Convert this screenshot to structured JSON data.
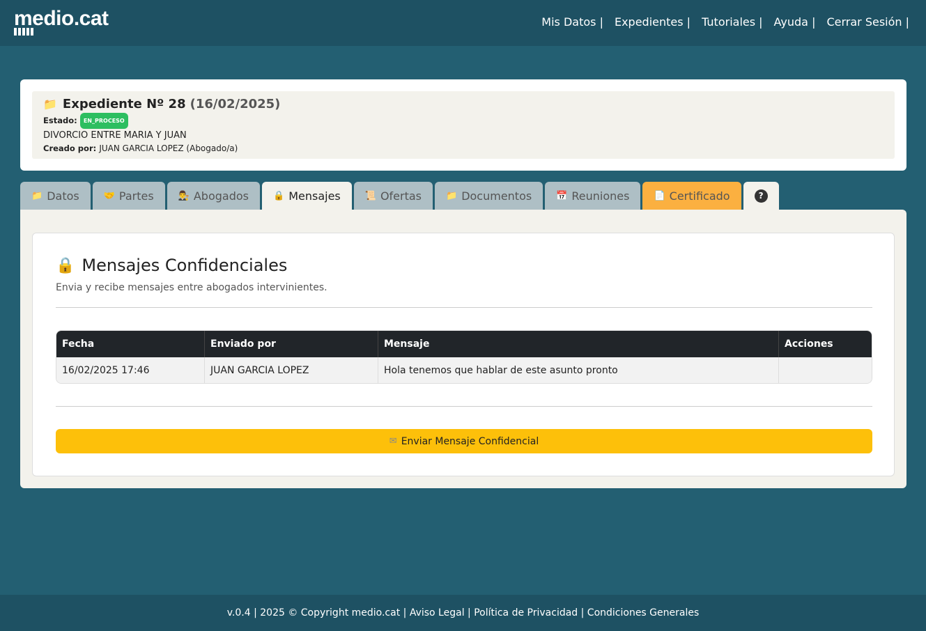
{
  "brand": {
    "name": "medio.cat"
  },
  "nav": {
    "items": [
      "Mis Datos |",
      "Expedientes |",
      "Tutoriales |",
      "Ayuda |",
      "Cerrar Sesión |"
    ]
  },
  "expediente": {
    "title": "Expediente Nº 28",
    "date": "(16/02/2025)",
    "estado_label": "Estado:",
    "estado_badge": "EN_PROCESO",
    "description": "DIVORCIO ENTRE MARIA Y JUAN",
    "creado_label": "Creado por:",
    "creado_value": "JUAN GARCIA LOPEZ (Abogado/a)"
  },
  "tabs": [
    {
      "label": "Datos",
      "icon": "folder-icon"
    },
    {
      "label": "Partes",
      "icon": "handshake-icon"
    },
    {
      "label": "Abogados",
      "icon": "lawyer-icon"
    },
    {
      "label": "Mensajes",
      "icon": "lock-icon"
    },
    {
      "label": "Ofertas",
      "icon": "scroll-icon"
    },
    {
      "label": "Documentos",
      "icon": "folder-icon"
    },
    {
      "label": "Reuniones",
      "icon": "calendar-icon"
    },
    {
      "label": "Certificado",
      "icon": "document-icon"
    }
  ],
  "section": {
    "title": "Mensajes Confidenciales",
    "subtitle": "Envia y recibe mensajes entre abogados intervinientes."
  },
  "table": {
    "headers": [
      "Fecha",
      "Enviado por",
      "Mensaje",
      "Acciones"
    ],
    "rows": [
      [
        "16/02/2025 17:46",
        "JUAN GARCIA LOPEZ",
        "Hola tenemos que hablar de este asunto pronto",
        ""
      ]
    ]
  },
  "send_button": {
    "label": "Enviar Mensaje Confidencial"
  },
  "footer": {
    "text": "v.0.4 | 2025 © Copyright medio.cat | Aviso Legal | Política de Privacidad | Condiciones Generales"
  },
  "colors": {
    "header_bg": "#1e5163",
    "page_bg": "#235f72",
    "badge_green": "#2dbe60",
    "cert_tab": "#fbb040",
    "send_button": "#fdc00a",
    "table_head": "#212529"
  }
}
